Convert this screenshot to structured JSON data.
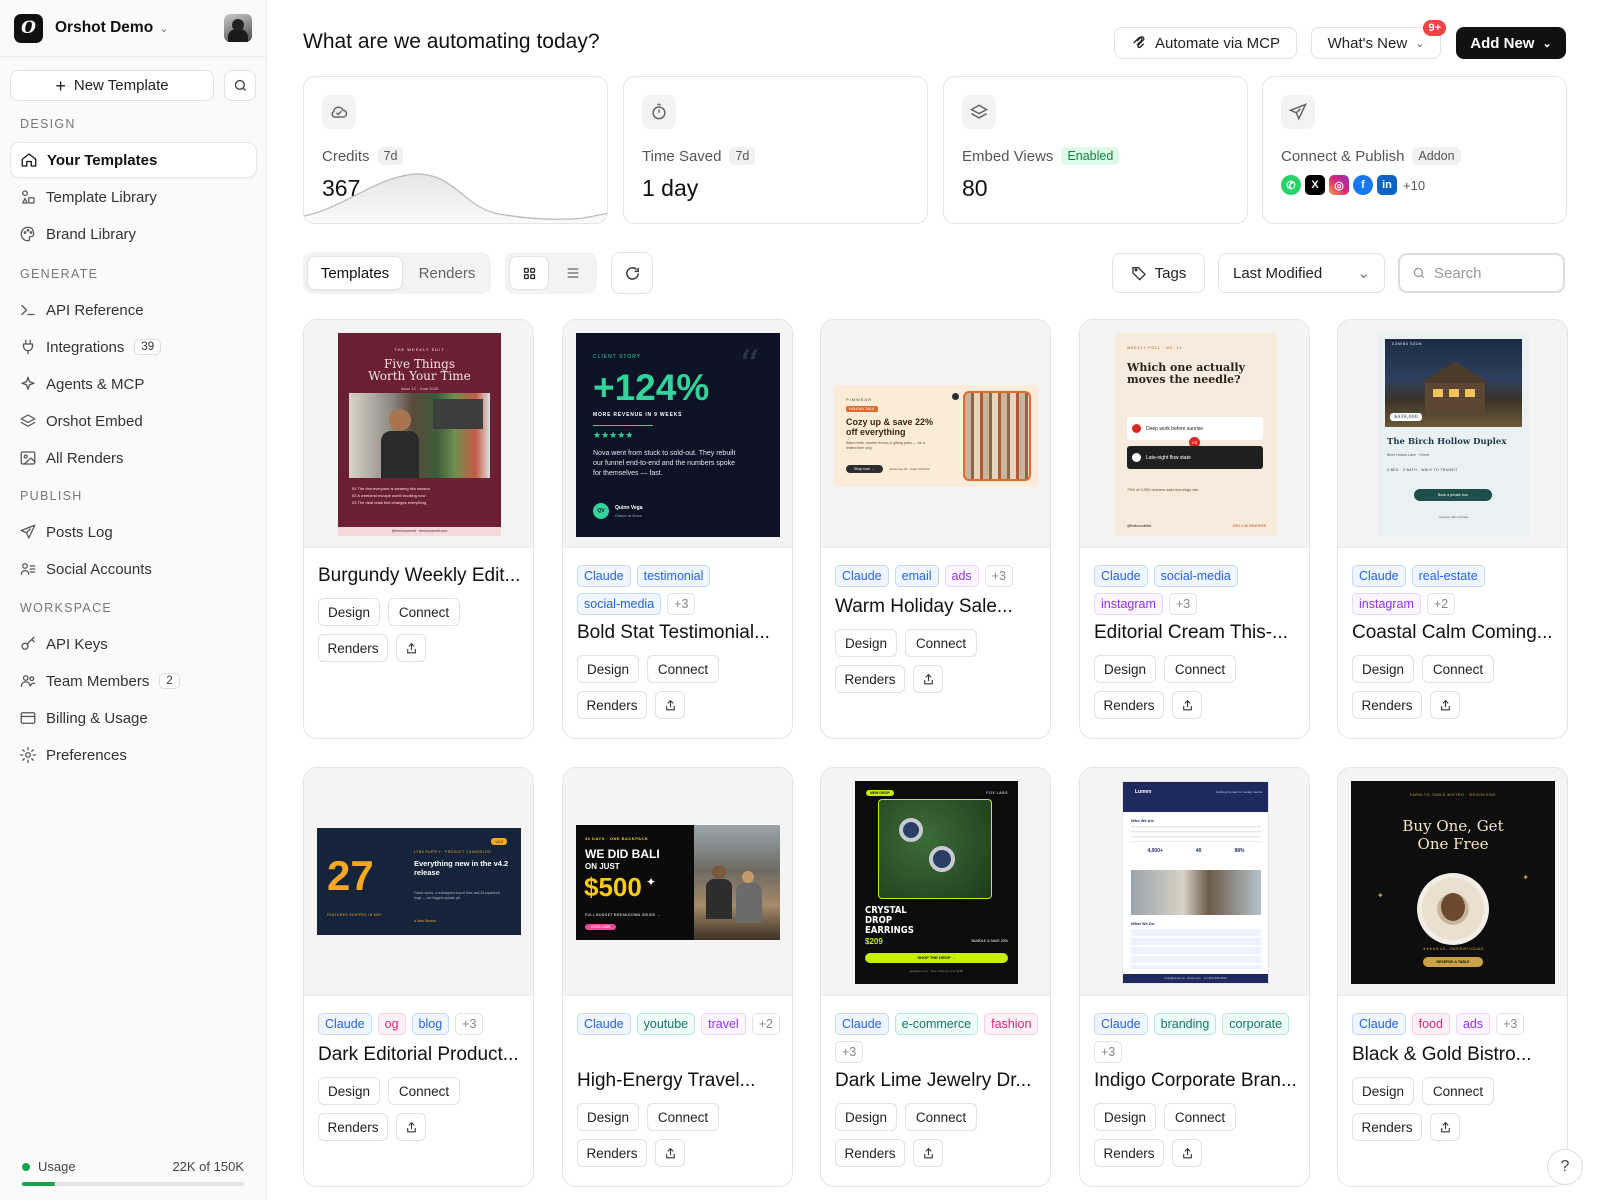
{
  "workspace": {
    "name": "Orshot Demo",
    "logo_letter": "O"
  },
  "sidebar": {
    "new_template_label": "New Template",
    "sections": [
      {
        "title": "DESIGN",
        "items": [
          {
            "label": "Your Templates",
            "icon": "home-icon",
            "active": true
          },
          {
            "label": "Template Library",
            "icon": "shapes-icon"
          },
          {
            "label": "Brand Library",
            "icon": "palette-icon"
          }
        ]
      },
      {
        "title": "GENERATE",
        "items": [
          {
            "label": "API Reference",
            "icon": "terminal-icon"
          },
          {
            "label": "Integrations",
            "icon": "plug-icon",
            "count": "39"
          },
          {
            "label": "Agents & MCP",
            "icon": "sparkles-icon"
          },
          {
            "label": "Orshot Embed",
            "icon": "layers-icon"
          },
          {
            "label": "All Renders",
            "icon": "image-icon"
          }
        ]
      },
      {
        "title": "PUBLISH",
        "items": [
          {
            "label": "Posts Log",
            "icon": "send-icon"
          },
          {
            "label": "Social Accounts",
            "icon": "user-list-icon"
          }
        ]
      },
      {
        "title": "WORKSPACE",
        "items": [
          {
            "label": "API Keys",
            "icon": "key-icon"
          },
          {
            "label": "Team Members",
            "icon": "users-icon",
            "count": "2"
          },
          {
            "label": "Billing & Usage",
            "icon": "credit-card-icon"
          },
          {
            "label": "Preferences",
            "icon": "gear-icon"
          }
        ]
      }
    ],
    "usage": {
      "label": "Usage",
      "value": "22K of 150K",
      "fraction": 0.147
    }
  },
  "header": {
    "title": "What are we automating today?",
    "mcp_label": "Automate via MCP",
    "whats_new_label": "What's New",
    "whats_new_badge": "9+",
    "add_new_label": "Add New"
  },
  "stats": [
    {
      "label": "Credits",
      "pill": "7d",
      "value": "367",
      "icon": "cloud-icon"
    },
    {
      "label": "Time Saved",
      "pill": "7d",
      "value": "1 day",
      "icon": "timer-icon"
    },
    {
      "label": "Embed Views",
      "pill": "Enabled",
      "value": "80",
      "icon": "layers-icon"
    },
    {
      "label": "Connect & Publish",
      "pill": "Addon",
      "extra": "+10",
      "icon": "send-icon"
    }
  ],
  "toolbar": {
    "tabs": [
      "Templates",
      "Renders"
    ],
    "tags_label": "Tags",
    "sort_label": "Last Modified",
    "search_placeholder": "Search"
  },
  "card_buttons": {
    "design": "Design",
    "connect": "Connect",
    "renders": "Renders"
  },
  "cards": [
    {
      "name": "Burgundy Weekly Edit...",
      "tags": []
    },
    {
      "name": "Bold Stat Testimonial...",
      "tags": [
        {
          "t": "Claude",
          "c": "blue"
        },
        {
          "t": "testimonial",
          "c": "blue"
        },
        {
          "t": "social-media",
          "c": "blue"
        },
        {
          "t": "+3",
          "c": "gray"
        }
      ]
    },
    {
      "name": "Warm Holiday Sale...",
      "tags": [
        {
          "t": "Claude",
          "c": "blue"
        },
        {
          "t": "email",
          "c": "blue"
        },
        {
          "t": "ads",
          "c": "purple"
        },
        {
          "t": "+3",
          "c": "gray"
        }
      ]
    },
    {
      "name": "Editorial Cream This-...",
      "tags": [
        {
          "t": "Claude",
          "c": "blue"
        },
        {
          "t": "social-media",
          "c": "blue"
        },
        {
          "t": "instagram",
          "c": "purple"
        },
        {
          "t": "+3",
          "c": "gray"
        }
      ]
    },
    {
      "name": "Coastal Calm Coming...",
      "tags": [
        {
          "t": "Claude",
          "c": "blue"
        },
        {
          "t": "real-estate",
          "c": "blue"
        },
        {
          "t": "instagram",
          "c": "purple"
        },
        {
          "t": "+2",
          "c": "gray"
        }
      ]
    },
    {
      "name": "Dark Editorial Product...",
      "tags": [
        {
          "t": "Claude",
          "c": "blue"
        },
        {
          "t": "og",
          "c": "pink"
        },
        {
          "t": "blog",
          "c": "blue"
        },
        {
          "t": "+3",
          "c": "gray"
        }
      ]
    },
    {
      "name": "High-Energy Travel...",
      "tags": [
        {
          "t": "Claude",
          "c": "blue"
        },
        {
          "t": "youtube",
          "c": "teal"
        },
        {
          "t": "travel",
          "c": "purple"
        },
        {
          "t": "+2",
          "c": "gray"
        }
      ]
    },
    {
      "name": "Dark Lime Jewelry Dr...",
      "tags": [
        {
          "t": "Claude",
          "c": "blue"
        },
        {
          "t": "e-commerce",
          "c": "teal"
        },
        {
          "t": "fashion",
          "c": "pink"
        },
        {
          "t": "+3",
          "c": "gray"
        }
      ]
    },
    {
      "name": "Indigo Corporate Bran...",
      "tags": [
        {
          "t": "Claude",
          "c": "blue"
        },
        {
          "t": "branding",
          "c": "teal"
        },
        {
          "t": "corporate",
          "c": "teal"
        },
        {
          "t": "+3",
          "c": "gray"
        }
      ]
    },
    {
      "name": "Black & Gold Bistro...",
      "tags": [
        {
          "t": "Claude",
          "c": "blue"
        },
        {
          "t": "food",
          "c": "pink"
        },
        {
          "t": "ads",
          "c": "purple"
        },
        {
          "t": "+3",
          "c": "gray"
        }
      ]
    }
  ],
  "thumbs": {
    "burgundy": {
      "kicker": "THE WEEKLY EDIT",
      "title": "Five Things Worth Your Time",
      "date": "Issue 12 · June 2026",
      "lines": [
        "01 The thin everyone is wearing this season",
        "02 A weekend escape worth booking now",
        "03 The deal retail find changes everything"
      ],
      "footer": "@thehouseedit · thehouseedit.com"
    },
    "stat": {
      "kicker": "CLIENT STORY",
      "big": "+124%",
      "sub": "MORE REVENUE IN 9 WEEKS",
      "stars": "★★★★★",
      "quote": "Nova went from stuck to sold-out. They rebuilt our funnel end-to-end and the numbers spoke for themselves — fast.",
      "initials": "QV",
      "person": "Quinn Vega",
      "role": "Owner at Nova"
    },
    "holiday": {
      "brand": "PIMWEAR",
      "badge": "HOLIDAY SALE",
      "headline": "Cozy up & save 22% off everything",
      "body": "Warm knits, woolen throws & gifting picks — for a limited time only.",
      "cta": "Shop now →",
      "end": "Ends Nov 30 · Code COZY22"
    },
    "editorial": {
      "kicker": "WEEKLY POLL · NO. 14",
      "question": "Which one actually moves the needle?",
      "a": "Deep work before sunrise",
      "b": "Late-night flow state",
      "vs": "VS",
      "note": "73% of 4,300 readers said mornings win.",
      "handle": "@thefocusletter",
      "join": "JOIN 4.3K READERS"
    },
    "coastal": {
      "kicker": "COMING SOON",
      "price": "$439,000",
      "title": "The Birch Hollow Duplex",
      "addr": "Birch Hollow Lane · Ghent",
      "spec": "3 BED · 3 BATH · WALK TO TRANSIT",
      "cta": "Book a private tour",
      "agent": "Listed by Sam Nichols"
    },
    "darked": {
      "num": "27",
      "badge": "v4.2",
      "kicker": "LYRA SUPPLY · PRODUCT CHANGELOG",
      "headline": "Everything new in the v4.2 release",
      "body": "Faster syncs, a redesigned export flow, and 25 squashed bugs — our biggest update yet.",
      "sub": "FEATURES SHIPPED IN MAY",
      "link": "● New Service"
    },
    "travel": {
      "kicker": "30 DAYS · ONE BACKPACK",
      "line1": "WE DID BALI",
      "line2": "ON JUST",
      "price": "$500",
      "sub": "FULL BUDGET BREAKDOWN INSIDE →",
      "badge": "COVE LABS"
    },
    "jewelry": {
      "badge": "NEW DROP",
      "brand": "FOX LABS",
      "title": "CRYSTAL DROP EARRINGS",
      "price": "$209",
      "bundle": "BUNDLE & SAVE 20%",
      "cta": "SHOP THE DROP →",
      "foot": "jewelbox.com · Free shipping over $100"
    },
    "indigo": {
      "brand": "Lumen",
      "tag": "Lighting the way for modern teams",
      "h1": "Who We Are",
      "stats": [
        "4,000+",
        "40",
        "98%"
      ],
      "h2": "What We Do",
      "foot": "hello@lumen.co · lumen.com · +1 (415) 555-0100"
    },
    "bistro": {
      "kicker": "FARM-TO-TABLE BISTRO · BROOKSIDE",
      "title": "Buy One, Get One Free",
      "stars": "★★★★★ 4.9 — RATED BY LOCALS",
      "cta": "RESERVE A TABLE"
    }
  },
  "colors": {
    "accent": "#111111",
    "usage_green": "#16a34a",
    "badge_red": "#ef4444"
  }
}
